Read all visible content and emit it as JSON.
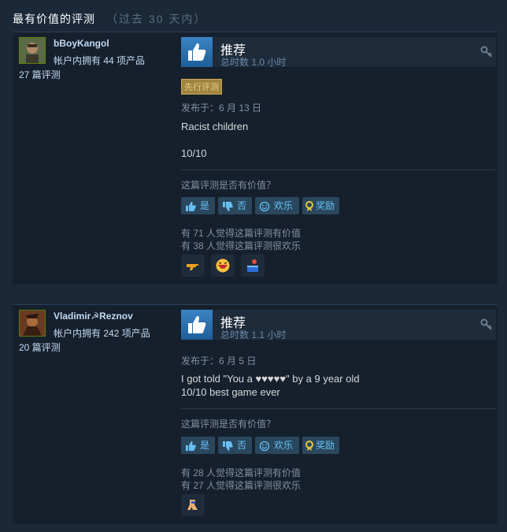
{
  "header": {
    "title": "最有价值的评测",
    "subtitle": "（过去 30 天内）"
  },
  "reviews": [
    {
      "author": "bBoyKangol",
      "products": "帐户内拥有 44 项产品",
      "review_count": "27 篇评测",
      "verdict": "推荐",
      "hours": "总时数 1.0 小时",
      "badge": "先行评测",
      "posted": "发布于：6 月 13 日",
      "body": "Racist children\n\n10/10",
      "helpful_question": "这篇评测是否有价值？",
      "buttons": {
        "yes": "是",
        "no": "否",
        "funny": "欢乐",
        "award": "奖励"
      },
      "helpful_stat": "有 71 人觉得这篇评测有价值",
      "funny_stat": "有 38 人觉得这篇评测很欢乐",
      "award_icons": [
        "gun-award-icon",
        "laughing-face-award-icon",
        "treasure-award-icon"
      ]
    },
    {
      "author": "Vladimir☭Reznov",
      "products": "帐户内拥有 242 项产品",
      "review_count": "20 篇评测",
      "verdict": "推荐",
      "hours": "总时数 1.1 小时",
      "posted": "发布于：6 月 5 日",
      "body": "I got told \"You a ♥♥♥♥♥\" by a 9 year old\n10/10 best game ever",
      "helpful_question": "这篇评测是否有价值？",
      "buttons": {
        "yes": "是",
        "no": "否",
        "funny": "欢乐",
        "award": "奖励"
      },
      "helpful_stat": "有 28 人觉得这篇评测有价值",
      "funny_stat": "有 27 人觉得这篇评测很欢乐",
      "award_icons": [
        "cowboy-award-icon"
      ]
    }
  ],
  "colors": {
    "background": "#1b2838",
    "panel": "#16202d",
    "accent": "#66c0f4",
    "thumb": "#3a83c4",
    "badge": "#a08540"
  }
}
